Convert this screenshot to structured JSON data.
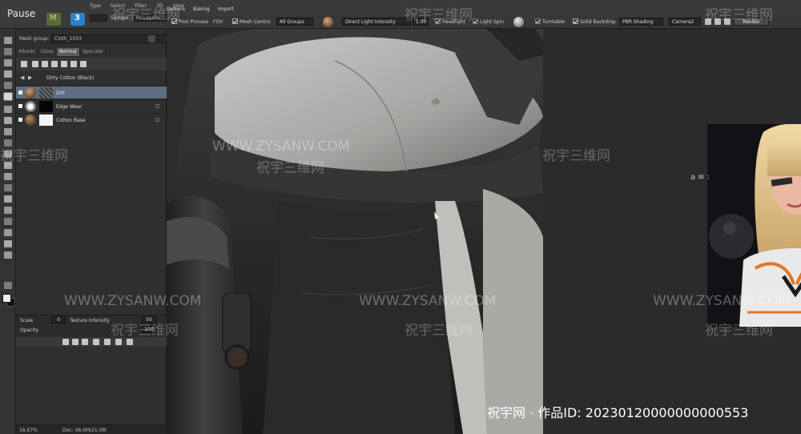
{
  "app": {
    "pause_label": "Pause",
    "menu_left": [
      "Type",
      "Select",
      "Filter",
      "3D",
      "View"
    ],
    "sample_label": "Sample:",
    "sample_value": "All Layers"
  },
  "viewport_menu": [
    "Options",
    "Baking",
    "Import"
  ],
  "viewport_toolbar": {
    "post_process": "Post Process",
    "fov": "FOV",
    "mesh_centric": "Mesh Centric",
    "groups": "All Groups",
    "light_label": "Direct Light Intensity",
    "light_value": "1.00",
    "headlight": "Headlight",
    "light_spin": "Light Spin",
    "turntable": "Turntable",
    "solid_backdrop": "Solid Backdrop",
    "shading": "PBR Shading",
    "camera": "Camera2",
    "render": "Render"
  },
  "panel": {
    "mesh_group_label": "Mesh group:",
    "mesh_group_value": "Cloth_1003",
    "map_tabs": [
      "Albedo",
      "Gloss",
      "Normal",
      "Specular"
    ],
    "active_tab": "Normal",
    "breadcrumb": "Dirty Cotton (Black)",
    "layers": [
      {
        "name": "Dirt",
        "selected": true
      },
      {
        "name": "Edge Wear",
        "selected": false
      },
      {
        "name": "Cotton Base",
        "selected": false
      }
    ],
    "scale_label": "Scale",
    "scale_value": "0",
    "texture_intensity_label": "Texture Intensity",
    "texture_intensity_value": "50",
    "opacity_label": "Opacity",
    "opacity_value": "100",
    "zoom": "16.67%",
    "doc_size": "Doc: 48.0M/21.0M"
  },
  "reference": {
    "logo_text": "a≡:"
  },
  "watermarks": {
    "url": "WWW.ZYSANW.COM",
    "cn": "祝宇三维网",
    "product_id": "祝宇网 · 作品ID:  20230120000000000553"
  },
  "colors": {
    "selection": "#5d6e84",
    "panel_bg": "#2f2f2f",
    "toolbar_bg": "#373737",
    "accent_orange": "#e0772b"
  }
}
